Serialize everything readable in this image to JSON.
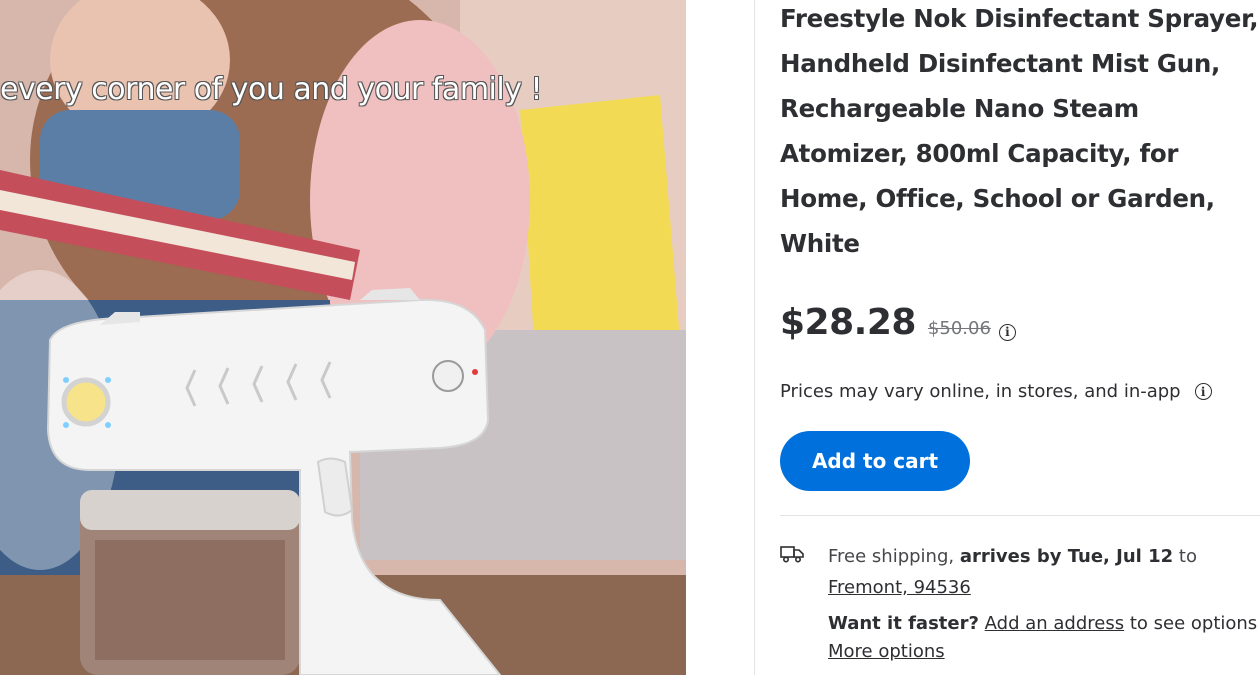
{
  "product": {
    "image_caption": "every corner of you and your family !",
    "title": "Freestyle Nok Disinfectant Sprayer, Handheld Disinfectant Mist Gun, Rechargeable Nano Steam Atomizer, 800ml Capacity, for Home, Office, School or Garden, White"
  },
  "pricing": {
    "current": "$28.28",
    "was": "$50.06",
    "info_glyph": "i",
    "vary_note": "Prices may vary online, in stores, and in-app",
    "vary_info_glyph": "i"
  },
  "cart": {
    "add_label": "Add to cart",
    "button_color": "#0071dc"
  },
  "shipping": {
    "icon": "truck-icon",
    "free_text": "Free shipping,",
    "arrives_text": "arrives by Tue, Jul 12",
    "to_text": "to",
    "location": "Fremont, 94536",
    "faster_label": "Want it faster?",
    "add_address": "Add an address",
    "see_options": "to see options",
    "more_options": "More options"
  }
}
